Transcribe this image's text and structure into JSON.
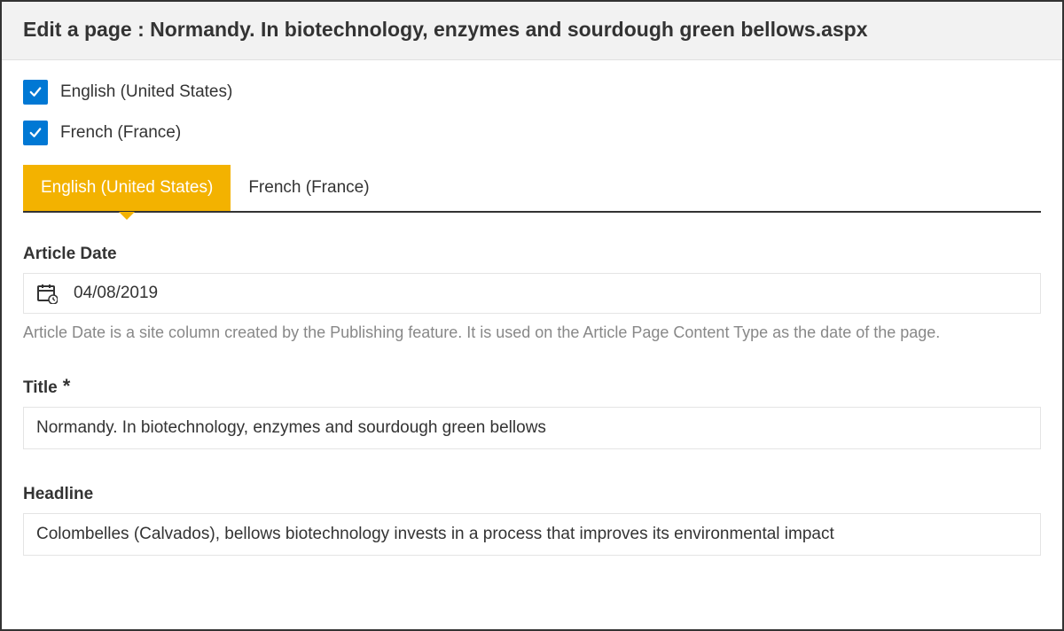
{
  "header": {
    "title": "Edit a page : Normandy. In biotechnology, enzymes and sourdough green bellows.aspx"
  },
  "languages": [
    {
      "label": "English (United States)",
      "checked": true
    },
    {
      "label": "French (France)",
      "checked": true
    }
  ],
  "tabs": [
    {
      "label": "English (United States)",
      "active": true
    },
    {
      "label": "French (France)",
      "active": false
    }
  ],
  "fields": {
    "article_date": {
      "label": "Article Date",
      "value": "04/08/2019",
      "help": "Article Date is a site column created by the Publishing feature. It is used on the Article Page Content Type as the date of the page."
    },
    "title": {
      "label": "Title",
      "required_mark": "*",
      "value": "Normandy. In biotechnology, enzymes and sourdough green bellows"
    },
    "headline": {
      "label": "Headline",
      "value": "Colombelles (Calvados), bellows biotechnology invests in a process that improves its environmental impact"
    }
  }
}
